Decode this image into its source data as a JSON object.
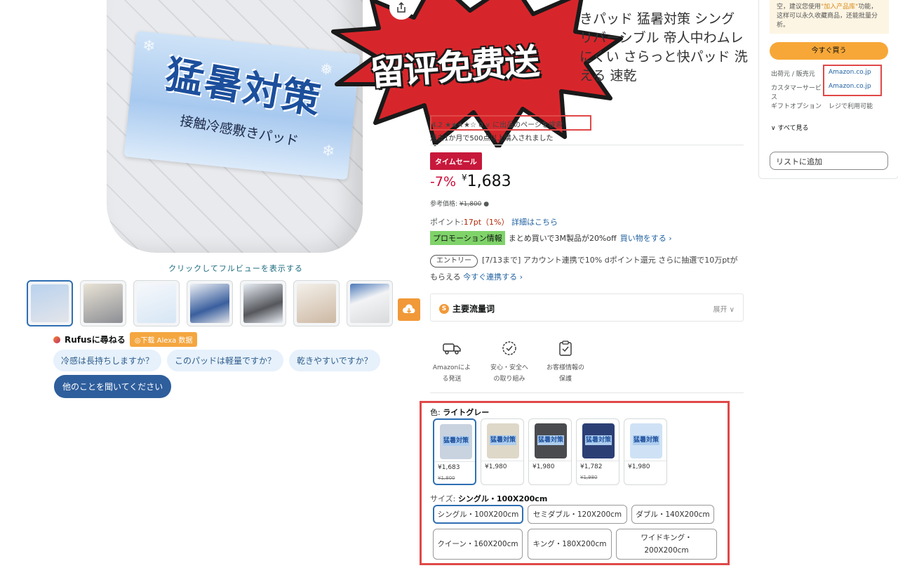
{
  "promo_overlay": {
    "text": "留评免费送"
  },
  "hero": {
    "band_title": "猛暑対策",
    "band_subtitle": "接触冷感敷きパッド",
    "click_hint": "クリックしてフルビューを表示する"
  },
  "thumbnails": {
    "count": 7,
    "selected_index": 0
  },
  "rufus": {
    "label": "Rufusに尋ねる",
    "alexa_button": "◎下载 Alexa 数据",
    "questions": [
      "冷感は長持ちしますか？",
      "このパッドは軽量ですか？",
      "乾きやすいですか？"
    ],
    "ask_other": "他のことを聞いてください"
  },
  "product": {
    "title": "きパッド 猛暑対策 シングリバーシブル 帝人中わムレにくい さらっと快パッド 洗える 速乾",
    "rating": "4.2 ★★★★☆ 0 ∨ に出品のページを検索",
    "sold_text": "過去1か月で500点以上購入されました",
    "sale_badge": "タイムセール",
    "discount": "-7%",
    "price_symbol": "¥",
    "price": "1,683",
    "ref_label": "参考価格:",
    "ref_price": "¥1,800",
    "ref_info_icon": "info-icon",
    "points_label": "ポイント:",
    "points_value": "17pt（1%）",
    "points_link": "詳細はこちら",
    "promo_tag": "プロモーション情報",
    "promo_text": "まとめ買いで3M製品が20%off",
    "promo_link": "買い物をする ›",
    "entry_tag": "エントリー",
    "entry_text": "[7/13まで] アカウント連携で10% dポイント還元 さらに抽選で10万ptがもらえる",
    "entry_link": "今すぐ連携する ›",
    "flow_title": "主要流量词",
    "flow_expand": "展开 ∨"
  },
  "features": [
    {
      "icon": "truck-icon",
      "label": "Amazonによる発送"
    },
    {
      "icon": "shield-badge-icon",
      "label": "安心・安全への取り組み"
    },
    {
      "icon": "clipboard-check-icon",
      "label": "お客様情報の保護"
    }
  ],
  "variants": {
    "color_label": "色:",
    "color_value": "ライトグレー",
    "colors": [
      {
        "price": "¥1,683",
        "old": "¥1,800",
        "swatch": "#c9d3e0",
        "label": "猛暑対策"
      },
      {
        "price": "¥1,980",
        "old": "",
        "swatch": "#ded8c9",
        "label": "猛暑対策"
      },
      {
        "price": "¥1,980",
        "old": "",
        "swatch": "#4a4b4f",
        "label": "猛暑対策"
      },
      {
        "price": "¥1,782",
        "old": "¥1,980",
        "swatch": "#2c3f75",
        "label": "猛暑対策"
      },
      {
        "price": "¥1,980",
        "old": "",
        "swatch": "#cfe2f5",
        "label": "猛暑対策"
      }
    ],
    "size_label": "サイズ:",
    "size_value": "シングル・100X200cm",
    "sizes": [
      "シングル・100X200cm",
      "セミダブル・120X200cm",
      "ダブル・140X200cm",
      "クイーン・160X200cm",
      "キング・180X200cm",
      "ワイドキング・200X200cm"
    ]
  },
  "buy_box": {
    "tip_prefix": "空，建议您使用",
    "tip_highlight": "\"加入产品库\"",
    "tip_suffix": "功能，这样可以永久收藏商品，还能批量分析。",
    "buy_now": "今すぐ買う",
    "seller_label": "出荷元 / 販売元",
    "seller_value": "Amazon.co.jp",
    "service_label": "カスタマーサービス",
    "service_value": "Amazon.co.jp",
    "gift_label": "ギフトオプション",
    "gift_value": "レジで利用可能",
    "see_all": "∨ すべて見る",
    "add_to_list": "リストに追加"
  }
}
